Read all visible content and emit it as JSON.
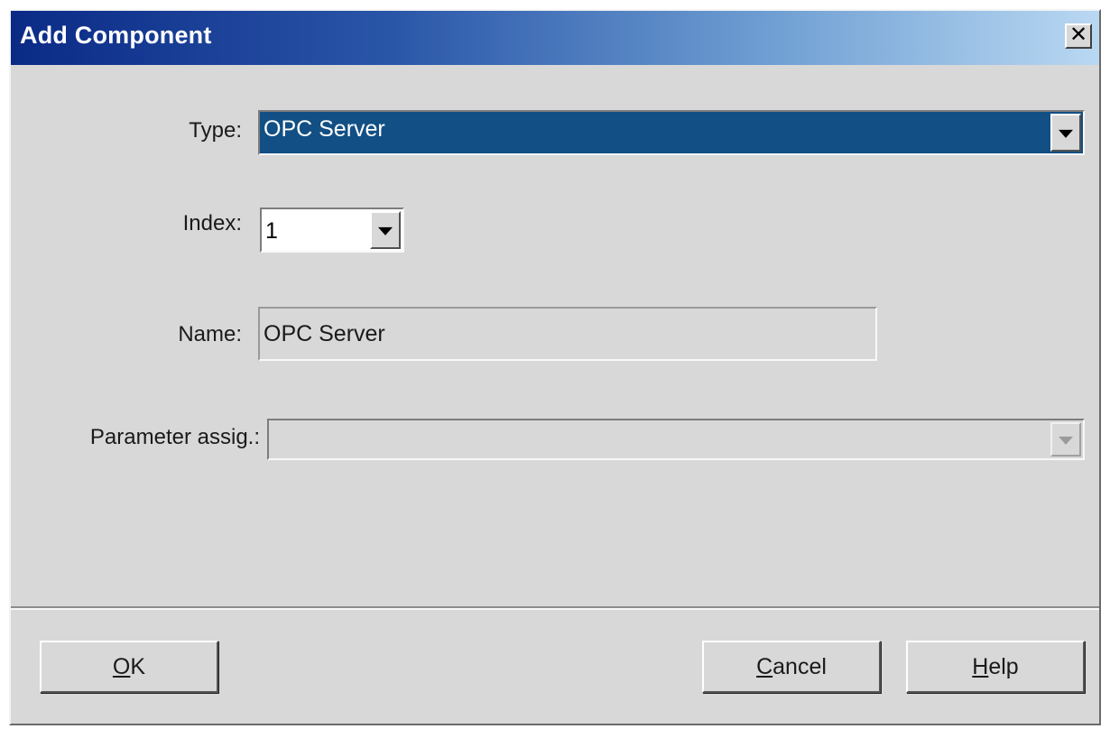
{
  "window": {
    "title": "Add Component",
    "close_glyph": "✕"
  },
  "form": {
    "type": {
      "label": "Type:",
      "value": "OPC Server"
    },
    "index": {
      "label": "Index:",
      "value": "1"
    },
    "name": {
      "label": "Name:",
      "value": "OPC Server"
    },
    "parameter": {
      "label": "Parameter assig.:",
      "value": ""
    }
  },
  "buttons": {
    "ok": {
      "mnemonic": "O",
      "rest": "K"
    },
    "cancel": {
      "mnemonic": "C",
      "rest": "ancel"
    },
    "help": {
      "mnemonic": "H",
      "rest": "elp"
    }
  },
  "colors": {
    "selection": "#124f84",
    "dialog_bg": "#d8d8d8",
    "title_start": "#0a2a86",
    "title_end": "#b9d8f2"
  }
}
